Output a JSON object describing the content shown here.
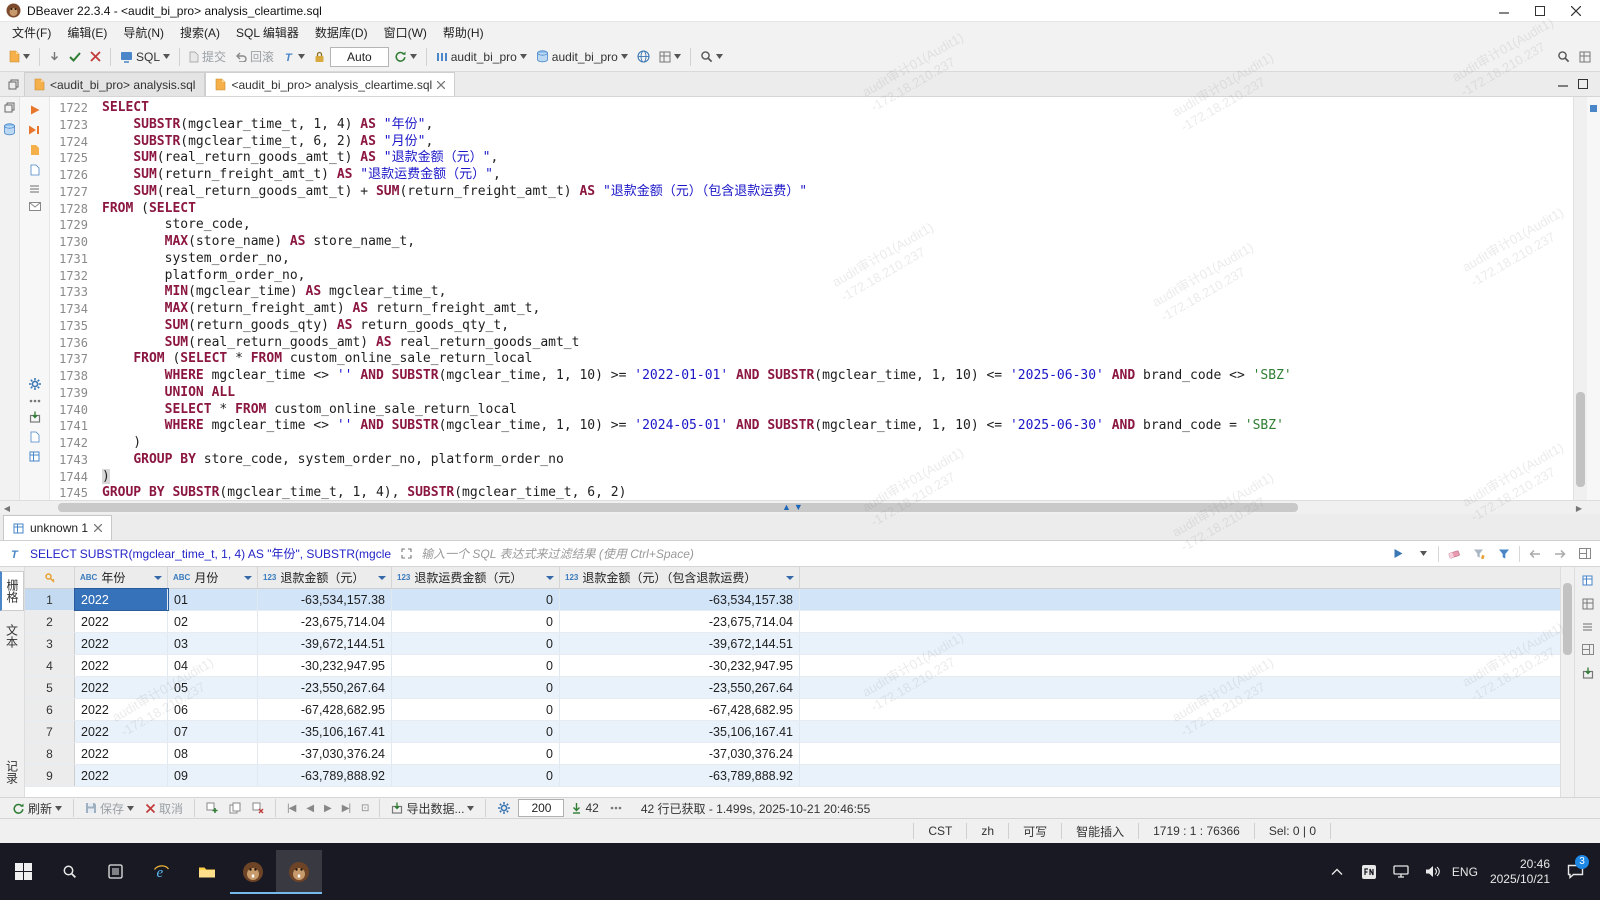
{
  "titlebar": {
    "title": "DBeaver 22.3.4 - <audit_bi_pro> analysis_cleartime.sql"
  },
  "menubar": [
    "文件(F)",
    "编辑(E)",
    "导航(N)",
    "搜索(A)",
    "SQL 编辑器",
    "数据库(D)",
    "窗口(W)",
    "帮助(H)"
  ],
  "toolbar": {
    "sql_button": "SQL",
    "commit": "提交",
    "rollback": "回滚",
    "auto": "Auto",
    "schema1": "audit_bi_pro",
    "schema2": "audit_bi_pro"
  },
  "editor_tabs": [
    {
      "label": "<audit_bi_pro> analysis.sql"
    },
    {
      "label": "<audit_bi_pro> analysis_cleartime.sql"
    }
  ],
  "watermark": {
    "text": "audit审计01(Audit1)\n-172.18.210.237"
  },
  "editor": {
    "lines": [
      {
        "no": "1722",
        "t": [
          [
            "k",
            "SELECT"
          ]
        ]
      },
      {
        "no": "1723",
        "t": [
          [
            "p",
            "    "
          ],
          [
            "k",
            "SUBSTR"
          ],
          [
            "p",
            "(mgclear_time_t, 1, 4) "
          ],
          [
            "k",
            "AS"
          ],
          [
            "p",
            " "
          ],
          [
            "s",
            "\"年份\""
          ],
          [
            "p",
            ","
          ]
        ]
      },
      {
        "no": "1724",
        "t": [
          [
            "p",
            "    "
          ],
          [
            "k",
            "SUBSTR"
          ],
          [
            "p",
            "(mgclear_time_t, 6, 2) "
          ],
          [
            "k",
            "AS"
          ],
          [
            "p",
            " "
          ],
          [
            "s",
            "\"月份\""
          ],
          [
            "p",
            ","
          ]
        ]
      },
      {
        "no": "1725",
        "t": [
          [
            "p",
            "    "
          ],
          [
            "k",
            "SUM"
          ],
          [
            "p",
            "(real_return_goods_amt_t) "
          ],
          [
            "k",
            "AS"
          ],
          [
            "p",
            " "
          ],
          [
            "s",
            "\"退款金额（元）\""
          ],
          [
            "p",
            ","
          ]
        ]
      },
      {
        "no": "1726",
        "t": [
          [
            "p",
            "    "
          ],
          [
            "k",
            "SUM"
          ],
          [
            "p",
            "(return_freight_amt_t) "
          ],
          [
            "k",
            "AS"
          ],
          [
            "p",
            " "
          ],
          [
            "s",
            "\"退款运费金额（元）\""
          ],
          [
            "p",
            ","
          ]
        ]
      },
      {
        "no": "1727",
        "t": [
          [
            "p",
            "    "
          ],
          [
            "k",
            "SUM"
          ],
          [
            "p",
            "(real_return_goods_amt_t) + "
          ],
          [
            "k",
            "SUM"
          ],
          [
            "p",
            "(return_freight_amt_t) "
          ],
          [
            "k",
            "AS"
          ],
          [
            "p",
            " "
          ],
          [
            "s",
            "\"退款金额（元）（包含退款运费）\""
          ]
        ]
      },
      {
        "no": "1728",
        "t": [
          [
            "k",
            "FROM"
          ],
          [
            "p",
            " ("
          ],
          [
            "k",
            "SELECT"
          ]
        ]
      },
      {
        "no": "1729",
        "t": [
          [
            "p",
            "        store_code,"
          ]
        ]
      },
      {
        "no": "1730",
        "t": [
          [
            "p",
            "        "
          ],
          [
            "k",
            "MAX"
          ],
          [
            "p",
            "(store_name) "
          ],
          [
            "k",
            "AS"
          ],
          [
            "p",
            " store_name_t,"
          ]
        ]
      },
      {
        "no": "1731",
        "t": [
          [
            "p",
            "        system_order_no,"
          ]
        ]
      },
      {
        "no": "1732",
        "t": [
          [
            "p",
            "        platform_order_no,"
          ]
        ]
      },
      {
        "no": "1733",
        "t": [
          [
            "p",
            "        "
          ],
          [
            "k",
            "MIN"
          ],
          [
            "p",
            "(mgclear_time) "
          ],
          [
            "k",
            "AS"
          ],
          [
            "p",
            " mgclear_time_t,"
          ]
        ]
      },
      {
        "no": "1734",
        "t": [
          [
            "p",
            "        "
          ],
          [
            "k",
            "MAX"
          ],
          [
            "p",
            "(return_freight_amt) "
          ],
          [
            "k",
            "AS"
          ],
          [
            "p",
            " return_freight_amt_t,"
          ]
        ]
      },
      {
        "no": "1735",
        "t": [
          [
            "p",
            "        "
          ],
          [
            "k",
            "SUM"
          ],
          [
            "p",
            "(return_goods_qty) "
          ],
          [
            "k",
            "AS"
          ],
          [
            "p",
            " return_goods_qty_t,"
          ]
        ]
      },
      {
        "no": "1736",
        "t": [
          [
            "p",
            "        "
          ],
          [
            "k",
            "SUM"
          ],
          [
            "p",
            "(real_return_goods_amt) "
          ],
          [
            "k",
            "AS"
          ],
          [
            "p",
            " real_return_goods_amt_t"
          ]
        ]
      },
      {
        "no": "1737",
        "t": [
          [
            "p",
            "    "
          ],
          [
            "k",
            "FROM"
          ],
          [
            "p",
            " ("
          ],
          [
            "k",
            "SELECT"
          ],
          [
            "p",
            " * "
          ],
          [
            "k",
            "FROM"
          ],
          [
            "p",
            " custom_online_sale_return_local"
          ]
        ]
      },
      {
        "no": "1738",
        "t": [
          [
            "p",
            "        "
          ],
          [
            "k",
            "WHERE"
          ],
          [
            "p",
            " mgclear_time <> "
          ],
          [
            "s",
            "''"
          ],
          [
            "p",
            " "
          ],
          [
            "k",
            "AND"
          ],
          [
            "p",
            " "
          ],
          [
            "k",
            "SUBSTR"
          ],
          [
            "p",
            "(mgclear_time, 1, 10) >= "
          ],
          [
            "s",
            "'2022-01-01'"
          ],
          [
            "p",
            " "
          ],
          [
            "k",
            "AND"
          ],
          [
            "p",
            " "
          ],
          [
            "k",
            "SUBSTR"
          ],
          [
            "p",
            "(mgclear_time, 1, 10) <= "
          ],
          [
            "s",
            "'2025-06-30'"
          ],
          [
            "p",
            " "
          ],
          [
            "k",
            "AND"
          ],
          [
            "p",
            " brand_code <> "
          ],
          [
            "g",
            "'SBZ'"
          ]
        ]
      },
      {
        "no": "1739",
        "t": [
          [
            "p",
            "        "
          ],
          [
            "k",
            "UNION ALL"
          ]
        ]
      },
      {
        "no": "1740",
        "t": [
          [
            "p",
            "        "
          ],
          [
            "k",
            "SELECT"
          ],
          [
            "p",
            " * "
          ],
          [
            "k",
            "FROM"
          ],
          [
            "p",
            " custom_online_sale_return_local"
          ]
        ]
      },
      {
        "no": "1741",
        "t": [
          [
            "p",
            "        "
          ],
          [
            "k",
            "WHERE"
          ],
          [
            "p",
            " mgclear_time <> "
          ],
          [
            "s",
            "''"
          ],
          [
            "p",
            " "
          ],
          [
            "k",
            "AND"
          ],
          [
            "p",
            " "
          ],
          [
            "k",
            "SUBSTR"
          ],
          [
            "p",
            "(mgclear_time, 1, 10) >= "
          ],
          [
            "s",
            "'2024-05-01'"
          ],
          [
            "p",
            " "
          ],
          [
            "k",
            "AND"
          ],
          [
            "p",
            " "
          ],
          [
            "k",
            "SUBSTR"
          ],
          [
            "p",
            "(mgclear_time, 1, 10) <= "
          ],
          [
            "s",
            "'2025-06-30'"
          ],
          [
            "p",
            " "
          ],
          [
            "k",
            "AND"
          ],
          [
            "p",
            " brand_code = "
          ],
          [
            "g",
            "'SBZ'"
          ]
        ]
      },
      {
        "no": "1742",
        "t": [
          [
            "p",
            "    )"
          ]
        ]
      },
      {
        "no": "1743",
        "t": [
          [
            "p",
            "    "
          ],
          [
            "k",
            "GROUP BY"
          ],
          [
            "p",
            " store_code, system_order_no, platform_order_no"
          ]
        ]
      },
      {
        "no": "1744",
        "t": [
          [
            "h",
            ")"
          ]
        ]
      },
      {
        "no": "1745",
        "t": [
          [
            "k",
            "GROUP BY"
          ],
          [
            "p",
            " "
          ],
          [
            "k",
            "SUBSTR"
          ],
          [
            "p",
            "(mgclear_time_t, 1, 4), "
          ],
          [
            "k",
            "SUBSTR"
          ],
          [
            "p",
            "(mgclear_time_t, 6, 2)"
          ]
        ]
      }
    ]
  },
  "results": {
    "tab": "unknown 1",
    "filter_sql": "SELECT SUBSTR(mgclear_time_t, 1, 4) AS \"年份\", SUBSTR(mgcle",
    "filter_placeholder": "输入一个 SQL 表达式来过滤结果 (使用 Ctrl+Space)",
    "side_tabs": [
      "栅格",
      "文本"
    ],
    "record_tab": "记录",
    "grid": {
      "columns": [
        {
          "icon": "ABC",
          "label": "年份"
        },
        {
          "icon": "ABC",
          "label": "月份"
        },
        {
          "icon": "123",
          "label": "退款金额（元）"
        },
        {
          "icon": "123",
          "label": "退款运费金额（元）"
        },
        {
          "icon": "123",
          "label": "退款金额（元）（包含退款运费）"
        }
      ],
      "rows": [
        {
          "n": "1",
          "year": "2022",
          "month": "01",
          "refund": "-63,534,157.38",
          "freight": "0",
          "total": "-63,534,157.38"
        },
        {
          "n": "2",
          "year": "2022",
          "month": "02",
          "refund": "-23,675,714.04",
          "freight": "0",
          "total": "-23,675,714.04"
        },
        {
          "n": "3",
          "year": "2022",
          "month": "03",
          "refund": "-39,672,144.51",
          "freight": "0",
          "total": "-39,672,144.51"
        },
        {
          "n": "4",
          "year": "2022",
          "month": "04",
          "refund": "-30,232,947.95",
          "freight": "0",
          "total": "-30,232,947.95"
        },
        {
          "n": "5",
          "year": "2022",
          "month": "05",
          "refund": "-23,550,267.64",
          "freight": "0",
          "total": "-23,550,267.64"
        },
        {
          "n": "6",
          "year": "2022",
          "month": "06",
          "refund": "-67,428,682.95",
          "freight": "0",
          "total": "-67,428,682.95"
        },
        {
          "n": "7",
          "year": "2022",
          "month": "07",
          "refund": "-35,106,167.41",
          "freight": "0",
          "total": "-35,106,167.41"
        },
        {
          "n": "8",
          "year": "2022",
          "month": "08",
          "refund": "-37,030,376.24",
          "freight": "0",
          "total": "-37,030,376.24"
        },
        {
          "n": "9",
          "year": "2022",
          "month": "09",
          "refund": "-63,789,888.92",
          "freight": "0",
          "total": "-63,789,888.92"
        }
      ]
    },
    "toolbar": {
      "refresh": "刷新",
      "save": "保存",
      "cancel": "取消",
      "export": "导出数据...",
      "fetch_size": "200",
      "row_count": "42",
      "status": "42 行已获取 - 1.499s, 2025-10-21 20:46:55"
    }
  },
  "statusbar": {
    "tz": "CST",
    "lang": "zh",
    "writable": "可写",
    "insert_mode": "智能插入",
    "position": "1719 : 1 : 76366",
    "selection": "Sel: 0 | 0"
  },
  "taskbar": {
    "lang": "ENG",
    "time": "20:46",
    "date": "2025/10/21",
    "badge": "3"
  }
}
